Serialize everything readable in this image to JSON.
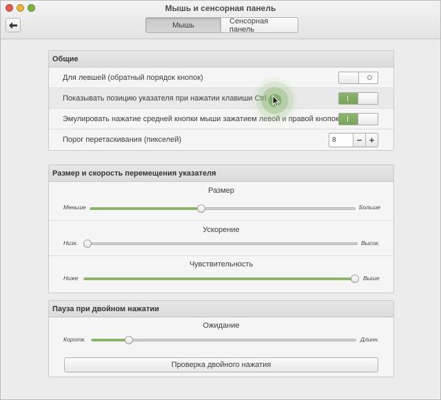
{
  "window": {
    "title": "Мышь и сенсорная панель",
    "tabs": [
      "Мышь",
      "Сенсорная панель"
    ],
    "active_tab": "Мышь"
  },
  "colors": {
    "accent": "#8bb36a",
    "background": "#ececec"
  },
  "general": {
    "title": "Общие",
    "left_handed": {
      "label": "Для левшей (обратный порядок кнопок)",
      "state": "off"
    },
    "show_pointer": {
      "label": "Показывать позицию указателя при нажатии клавиши Ctrl",
      "state": "on"
    },
    "emulate_middle": {
      "label": "Эмулировать нажатие средней кнопки мыши зажатием левой и правой кнопок",
      "state": "on"
    },
    "drag_threshold": {
      "label": "Порог перетаскивания (пикселей)",
      "value": "8",
      "minus": "−",
      "plus": "+"
    }
  },
  "pointer": {
    "title": "Размер и скорость перемещения указателя",
    "size": {
      "title": "Размер",
      "min": "Меньше",
      "max": "Больше",
      "fraction": 0.42
    },
    "acceleration": {
      "title": "Ускорение",
      "min": "Низк.",
      "max": "Высок.",
      "fraction": 0.0
    },
    "sensitivity": {
      "title": "Чувствительность",
      "min": "Ниже",
      "max": "Выше",
      "fraction": 1.0
    }
  },
  "double_click": {
    "title": "Пауза при двойном нажатии",
    "timeout": {
      "title": "Ожидание",
      "min": "Коротк.",
      "max": "Длинн.",
      "fraction": 0.14
    },
    "test_button": "Проверка двойного нажатия"
  }
}
